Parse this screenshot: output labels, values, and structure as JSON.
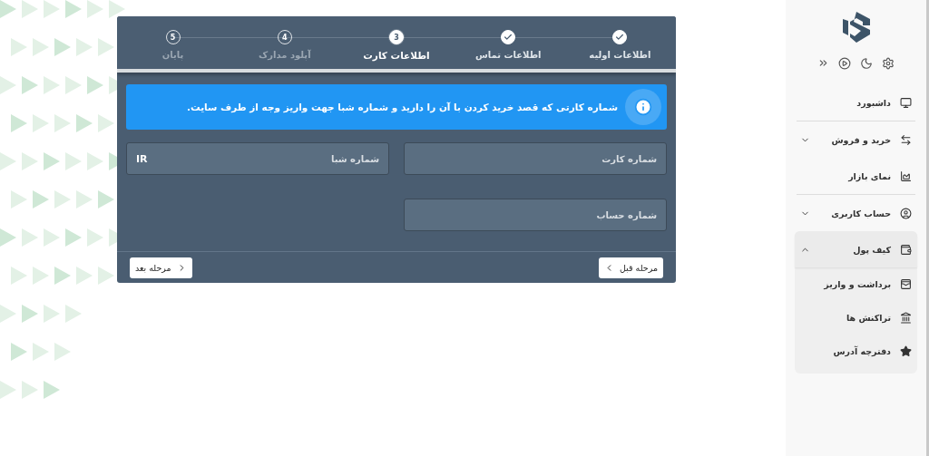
{
  "wizard": {
    "steps": [
      {
        "label": "اطلاعات اولیه",
        "completed": true,
        "selected": false
      },
      {
        "label": "اطلاعات تماس",
        "completed": true,
        "selected": false
      },
      {
        "label": "اطلاعات کارت",
        "completed": false,
        "selected": true,
        "number": "3"
      },
      {
        "label": "آپلود مدارک",
        "completed": false,
        "selected": false,
        "number": "4"
      },
      {
        "label": "پایان",
        "completed": false,
        "selected": false,
        "number": "5"
      }
    ],
    "notice": "شماره کارتی که قصد خرید کردن با آن را دارید و شماره شبا جهت واریز وجه از طرف سایت.",
    "fields": [
      {
        "placeholder": "شماره کارت"
      },
      {
        "placeholder": "شماره شبا",
        "prefix": "IR"
      },
      {
        "placeholder": "شماره حساب"
      }
    ],
    "buttons": [
      {
        "label": "مرحله قبل",
        "kind": "prev"
      },
      {
        "label": "مرحله بعد",
        "kind": "next"
      }
    ]
  },
  "sidebar": {
    "items": [
      {
        "label": "داشبورد",
        "divider_after": true
      },
      {
        "label": "خرید و فروش",
        "expandable": true,
        "expanded": false
      },
      {
        "label": "نمای بازار",
        "divider_after": true
      },
      {
        "label": "حساب کاربری",
        "expandable": true,
        "expanded": false
      },
      {
        "label": "کیف پول",
        "expandable": true,
        "expanded": true,
        "children": [
          {
            "label": "برداشت و واریز"
          },
          {
            "label": "تراکنش ها"
          },
          {
            "label": "دفترچه آدرس"
          }
        ]
      }
    ]
  }
}
